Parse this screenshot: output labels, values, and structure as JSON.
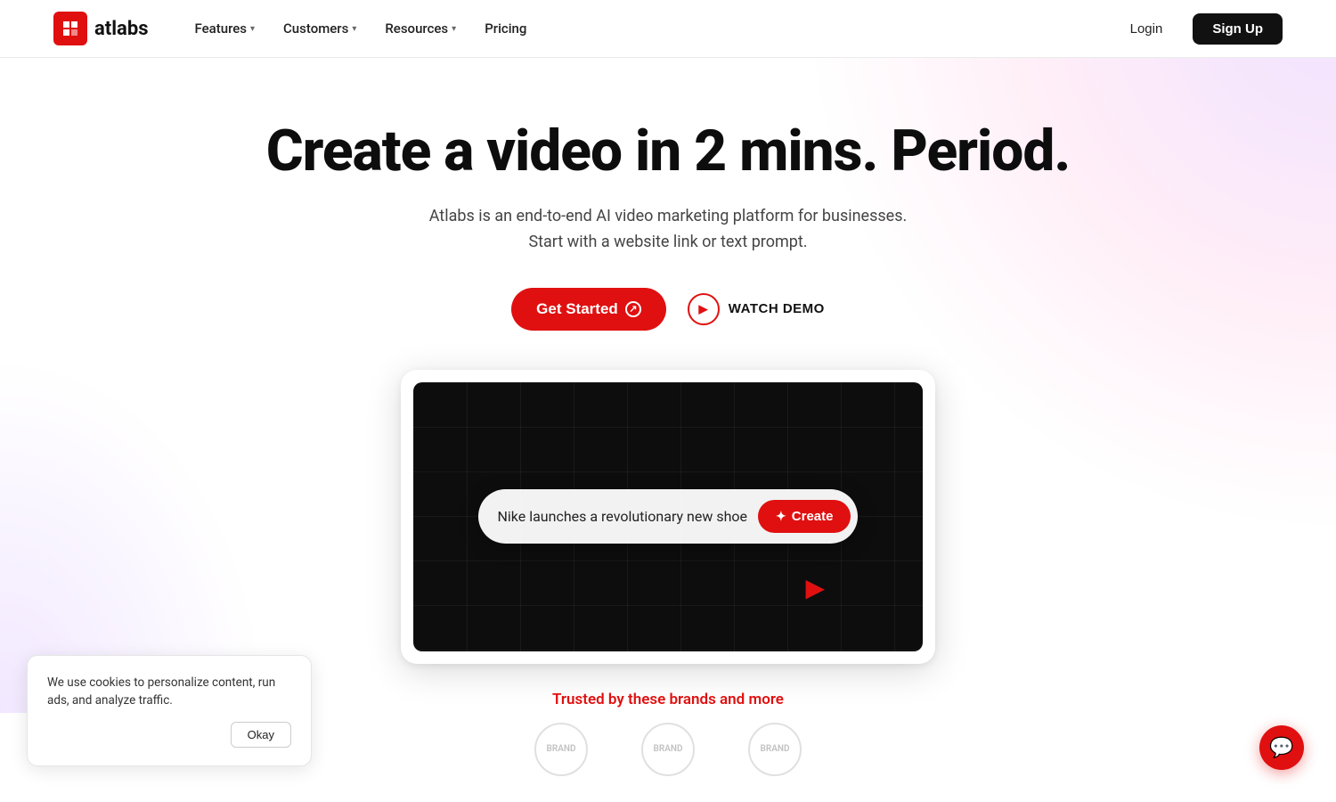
{
  "nav": {
    "logo_text": "atlabs",
    "links": [
      {
        "label": "Features",
        "has_dropdown": true
      },
      {
        "label": "Customers",
        "has_dropdown": true
      },
      {
        "label": "Resources",
        "has_dropdown": true
      },
      {
        "label": "Pricing",
        "has_dropdown": false
      }
    ],
    "login_label": "Login",
    "signup_label": "Sign Up"
  },
  "hero": {
    "title": "Create a video in 2 mins. Period.",
    "subtitle_line1": "Atlabs is an end-to-end AI video marketing platform for businesses.",
    "subtitle_line2": "Start with a website link or text prompt.",
    "cta_primary": "Get Started",
    "cta_secondary": "WATCH DEMO",
    "video_prompt": "Nike launches a revolutionary new shoe",
    "create_btn": "Create"
  },
  "trusted": {
    "label": "Trusted by these brands and more"
  },
  "cookie": {
    "text": "We use cookies to personalize content, run ads, and analyze traffic.",
    "okay_label": "Okay"
  },
  "icons": {
    "arrow_up_right": "↗",
    "chevron_down": "▾",
    "play": "▶",
    "sparkle": "✦",
    "chat": "💬",
    "cursor": "▶"
  }
}
